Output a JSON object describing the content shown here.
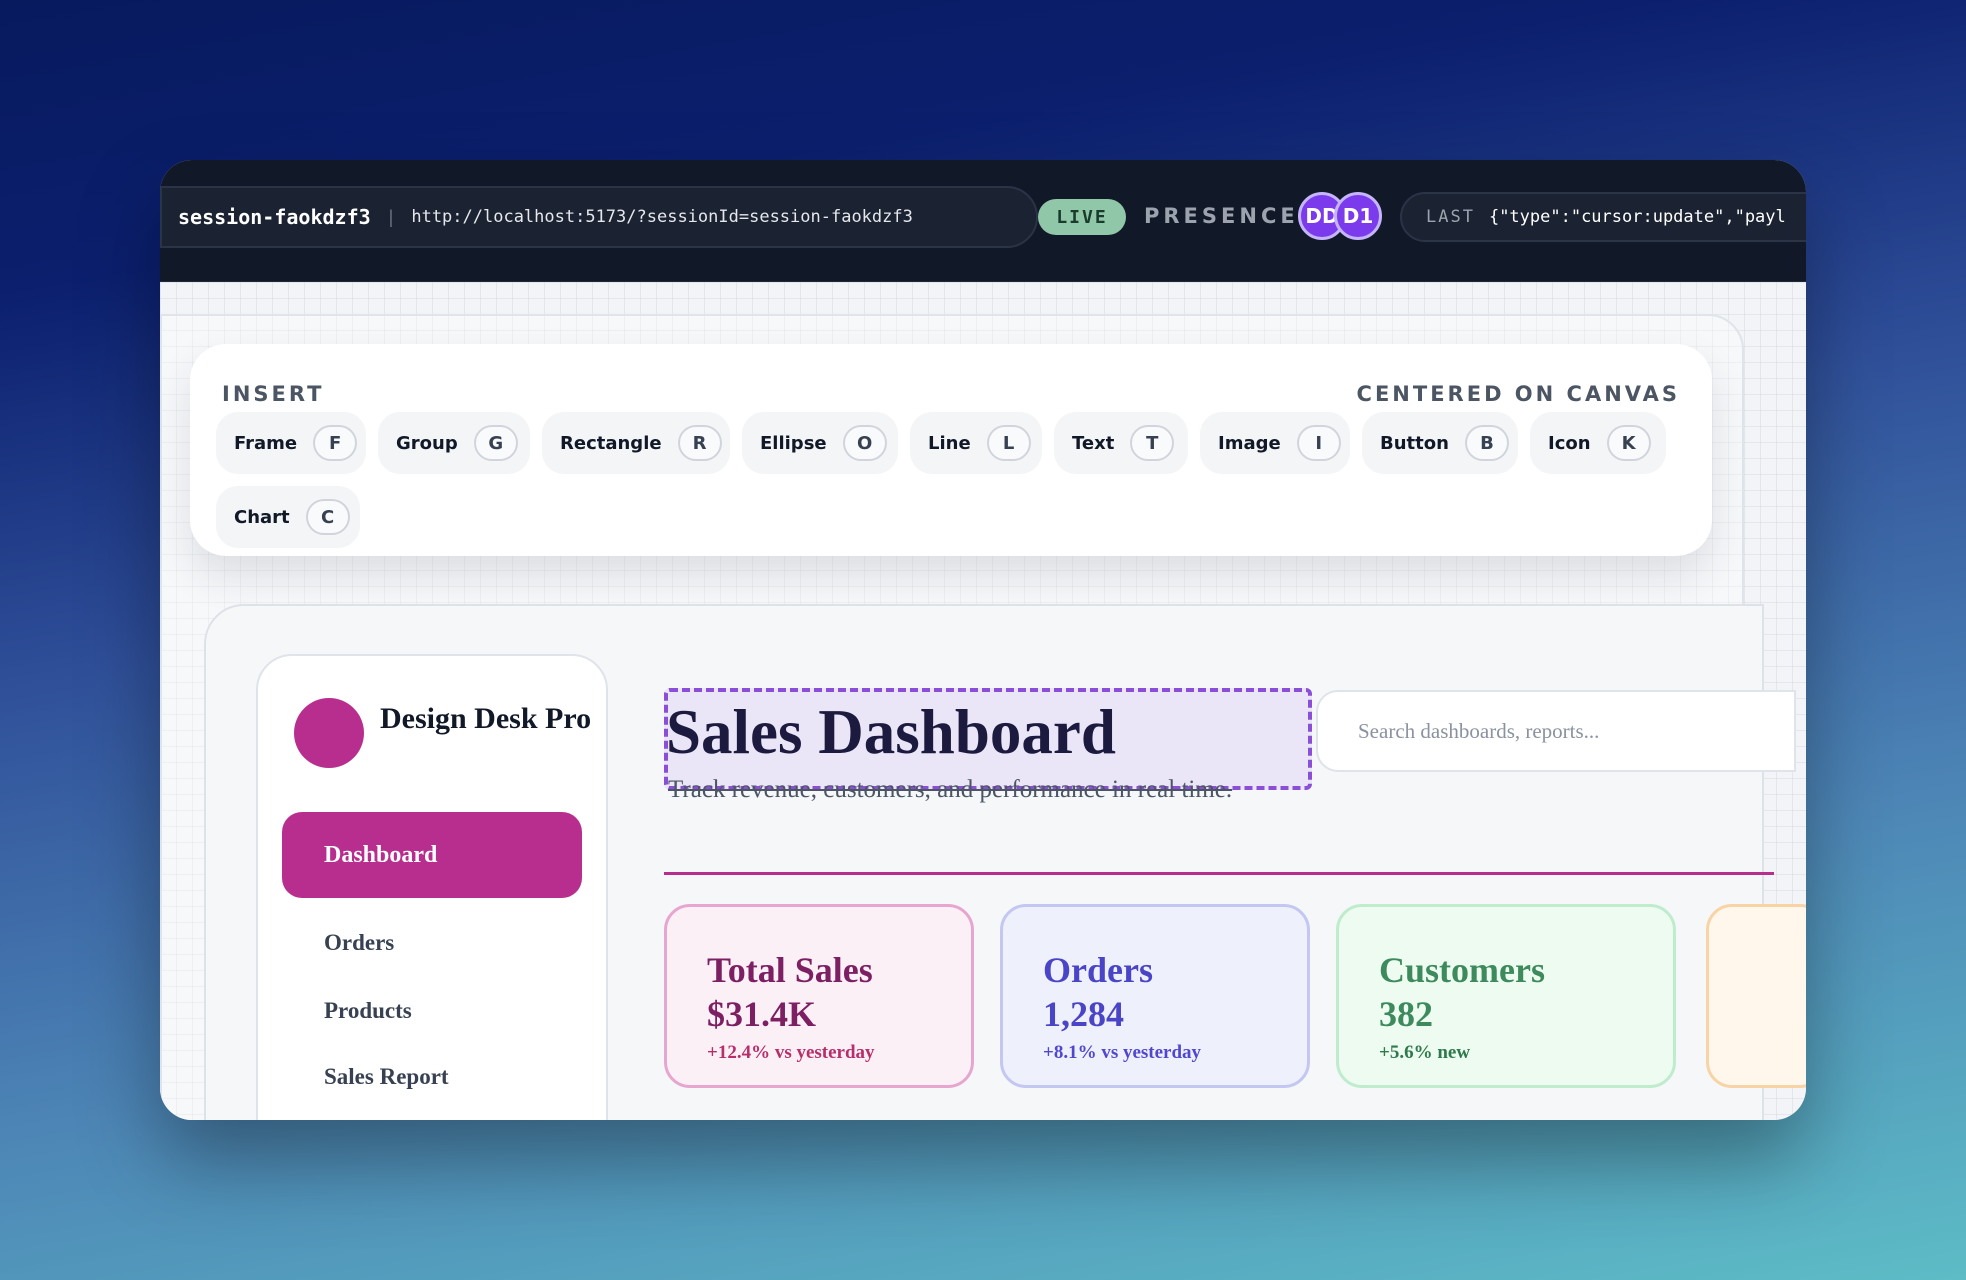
{
  "topbar": {
    "session_id": "session-faokdzf3",
    "separator": "|",
    "url": "http://localhost:5173/?sessionId=session-faokdzf3",
    "live_label": "LIVE",
    "presence_label": "PRESENCE",
    "avatars": [
      "DD",
      "D1"
    ],
    "last_label": "LAST",
    "last_value": "{\"type\":\"cursor:update\",\"payl"
  },
  "insert_panel": {
    "title": "INSERT",
    "position_label": "CENTERED ON CANVAS",
    "tools": [
      {
        "name": "Frame",
        "key": "F"
      },
      {
        "name": "Group",
        "key": "G"
      },
      {
        "name": "Rectangle",
        "key": "R"
      },
      {
        "name": "Ellipse",
        "key": "O"
      },
      {
        "name": "Line",
        "key": "L"
      },
      {
        "name": "Text",
        "key": "T"
      },
      {
        "name": "Image",
        "key": "I"
      },
      {
        "name": "Button",
        "key": "B"
      },
      {
        "name": "Icon",
        "key": "K"
      },
      {
        "name": "Chart",
        "key": "C"
      }
    ]
  },
  "design": {
    "brand_name": "Design Desk Pro",
    "nav": [
      "Dashboard",
      "Orders",
      "Products",
      "Sales Report"
    ],
    "page_title": "Sales Dashboard",
    "page_subtitle": "Track revenue, customers, and performance in real time.",
    "search_placeholder": "Search dashboards, reports...",
    "stats": [
      {
        "label": "Total Sales",
        "value": "$31.4K",
        "delta": "+12.4% vs yesterday"
      },
      {
        "label": "Orders",
        "value": "1,284",
        "delta": "+8.1% vs yesterday"
      },
      {
        "label": "Customers",
        "value": "382",
        "delta": "+5.6% new"
      }
    ]
  },
  "colors": {
    "accent": "#b82e8e",
    "selection": "#8a4fd6",
    "live": "#8fc7a8",
    "avatar": "#7c3aed"
  }
}
